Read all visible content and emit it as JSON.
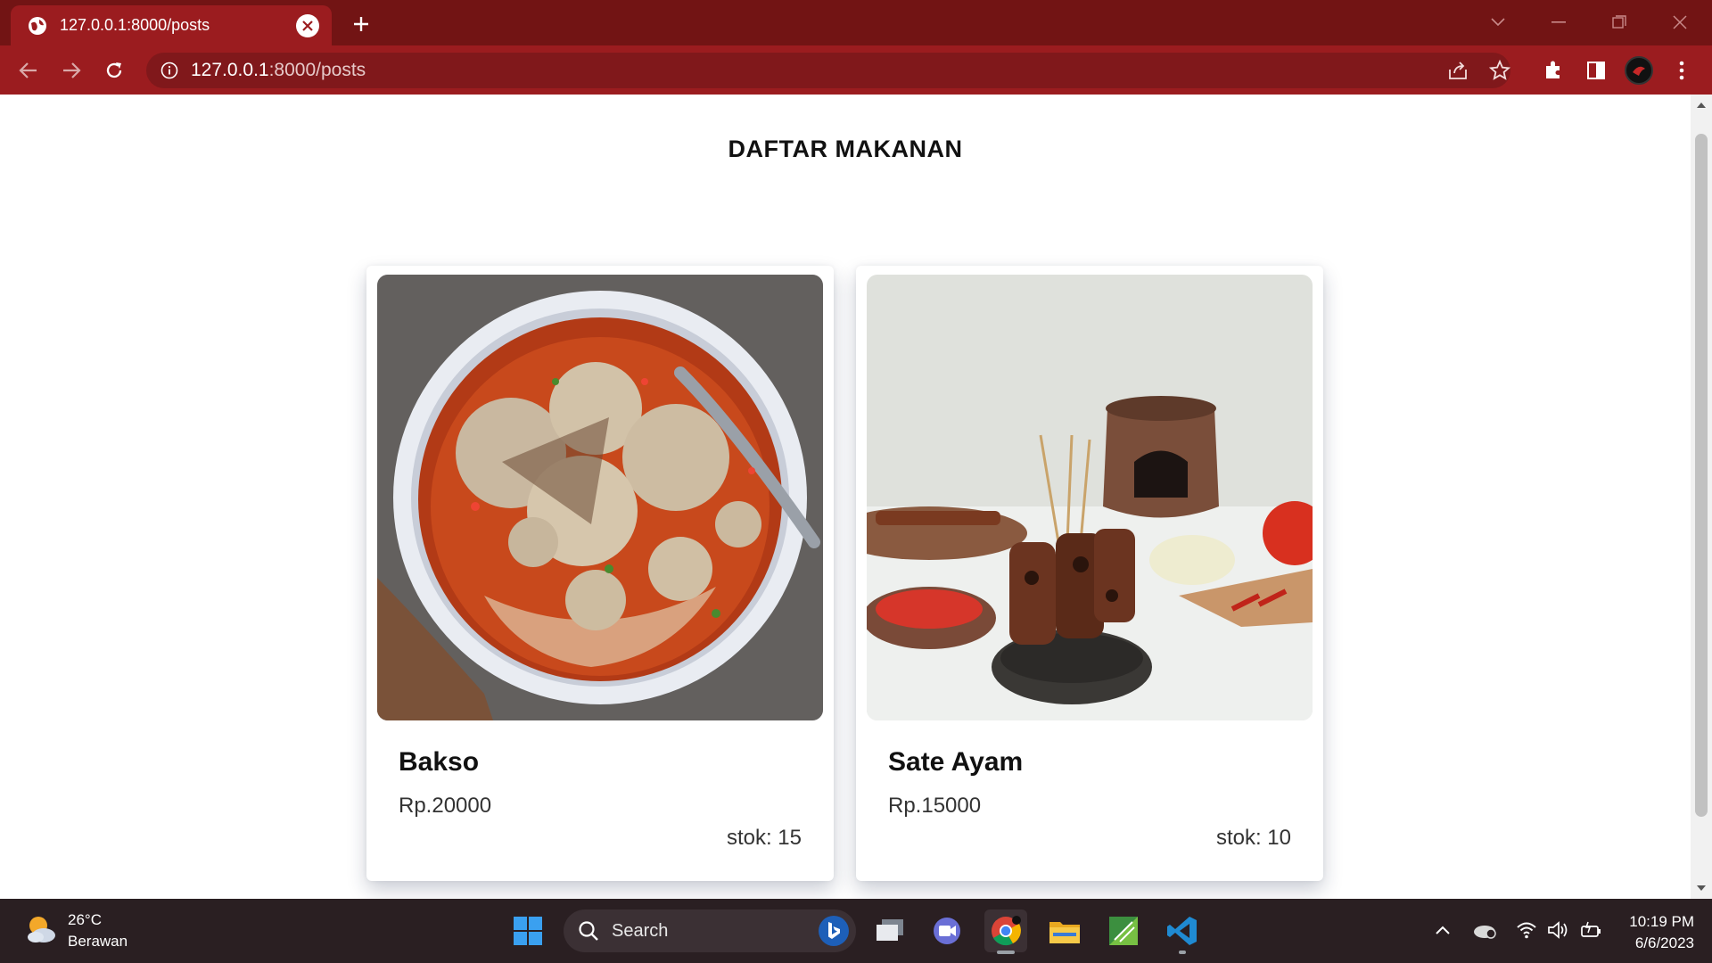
{
  "browser": {
    "tab_title": "127.0.0.1:8000/posts",
    "url_host": "127.0.0.1",
    "url_path": ":8000/posts"
  },
  "page": {
    "heading": "DAFTAR MAKANAN",
    "foods": [
      {
        "name": "Bakso",
        "price": "Rp.20000",
        "stock": "stok: 15"
      },
      {
        "name": "Sate Ayam",
        "price": "Rp.15000",
        "stock": "stok: 10"
      }
    ]
  },
  "taskbar": {
    "temperature": "26°C",
    "weather_condition": "Berawan",
    "search_label": "Search",
    "time": "10:19 PM",
    "date": "6/6/2023"
  },
  "colors": {
    "tab_strip": "#721414",
    "toolbar": "#9b1c1f",
    "taskbar": "#2a1f22"
  }
}
